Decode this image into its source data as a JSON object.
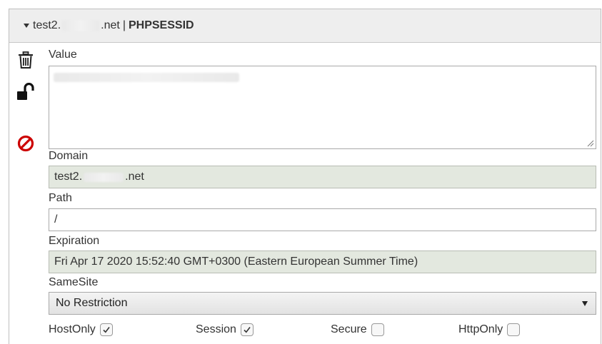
{
  "header": {
    "domain_prefix": "test2.",
    "domain_suffix": ".net",
    "separator": "|",
    "cookie_name": "PHPSESSID"
  },
  "icons": {
    "delete": "trash-icon",
    "protect": "unlock-icon",
    "block": "block-icon",
    "accent": "#cc0000"
  },
  "fields": {
    "value_label": "Value",
    "domain_label": "Domain",
    "domain_prefix": "test2.",
    "domain_suffix": ".net",
    "path_label": "Path",
    "path_value": "/",
    "expiration_label": "Expiration",
    "expiration_value": "Fri Apr 17 2020 15:52:40 GMT+0300 (Eastern European Summer Time)",
    "samesite_label": "SameSite",
    "samesite_value": "No Restriction"
  },
  "checkboxes": [
    {
      "label": "HostOnly",
      "checked": true
    },
    {
      "label": "Session",
      "checked": true
    },
    {
      "label": "Secure",
      "checked": false
    },
    {
      "label": "HttpOnly",
      "checked": false
    }
  ]
}
